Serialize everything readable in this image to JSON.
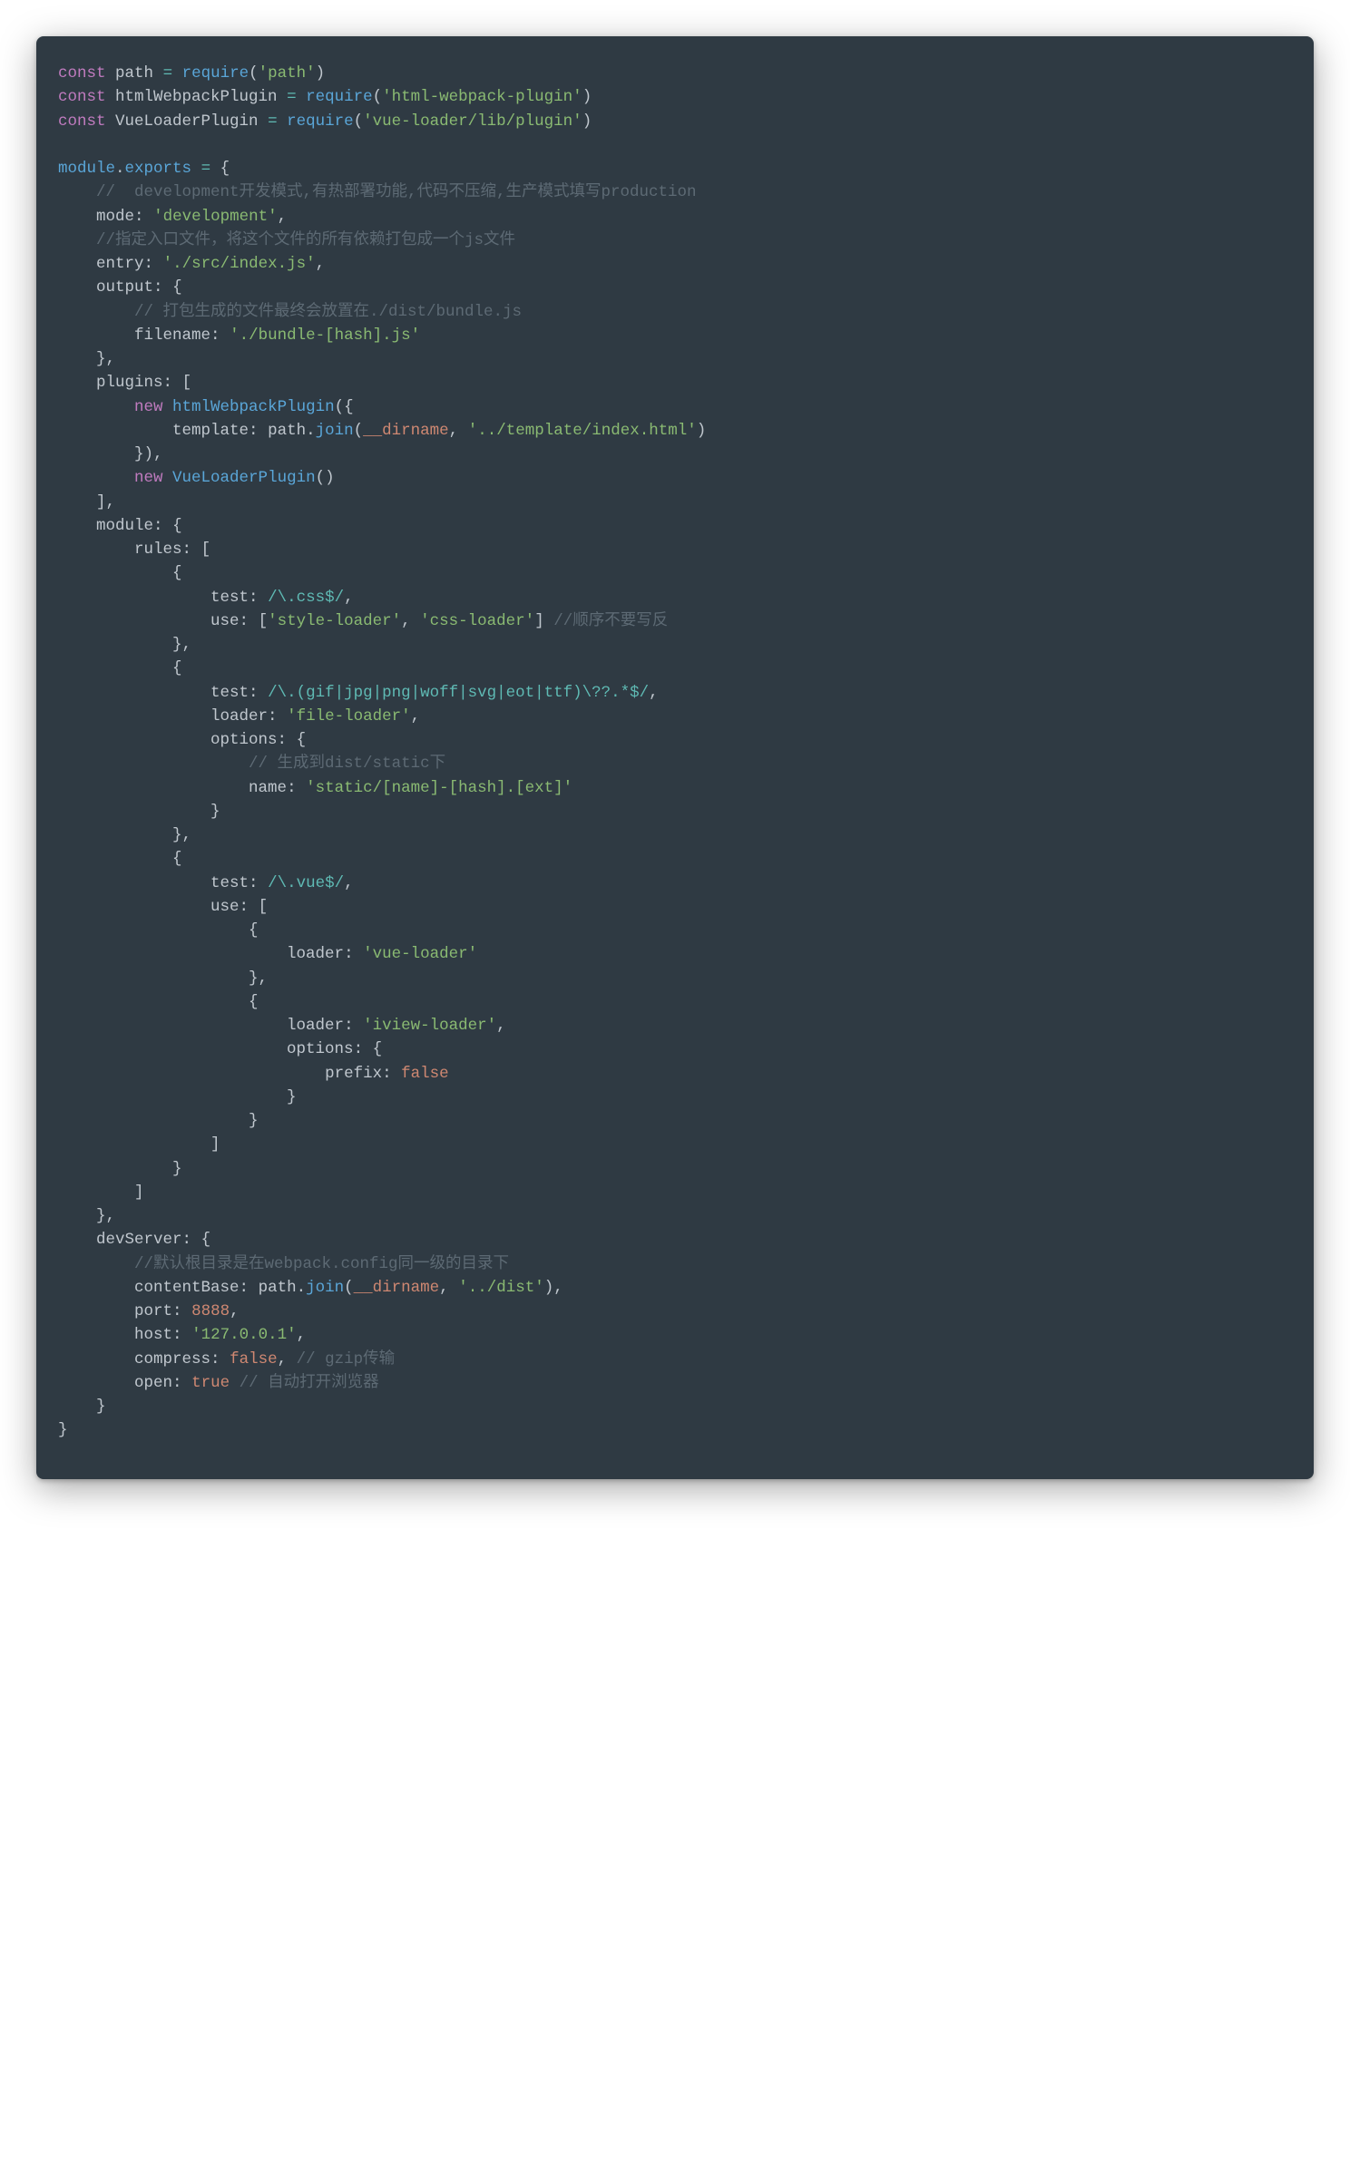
{
  "code": {
    "imports": {
      "const_kw": "const",
      "require_fn": "require",
      "path_var": "path",
      "path_mod": "'path'",
      "html_var": "htmlWebpackPlugin",
      "html_mod": "'html-webpack-plugin'",
      "vue_var": "VueLoaderPlugin",
      "vue_mod": "'vue-loader/lib/plugin'"
    },
    "exports_head": {
      "module": "module",
      "exports": "exports"
    },
    "comments": {
      "mode": "//  development开发模式,有热部署功能,代码不压缩,生产模式填写production",
      "entry": "//指定入口文件，将这个文件的所有依赖打包成一个js文件",
      "output": "// 打包生成的文件最终会放置在./dist/bundle.js",
      "use_css": "//顺序不要写反",
      "static": "// 生成到dist/static下",
      "contentBase": "//默认根目录是在webpack.config同一级的目录下",
      "gzip": "// gzip传输",
      "open": "// 自动打开浏览器"
    },
    "config": {
      "mode_key": "mode",
      "mode_val": "'development'",
      "entry_key": "entry",
      "entry_val": "'./src/index.js'",
      "output_key": "output",
      "filename_key": "filename",
      "filename_val": "'./bundle-[hash].js'",
      "plugins_key": "plugins",
      "new_kw": "new",
      "htmlPlugin": "htmlWebpackPlugin",
      "template_key": "template",
      "join_fn": "join",
      "dirname": "__dirname",
      "template_path": "'../template/index.html'",
      "vuePlugin": "VueLoaderPlugin",
      "module_key": "module",
      "rules_key": "rules",
      "test_key": "test",
      "use_key": "use",
      "loader_key": "loader",
      "options_key": "options",
      "name_key": "name",
      "prefix_key": "prefix",
      "css_test": "/\\.css$/",
      "style_loader": "'style-loader'",
      "css_loader": "'css-loader'",
      "file_test": "/\\.(gif|jpg|png|woff|svg|eot|ttf)\\??.*$/",
      "file_loader": "'file-loader'",
      "static_name": "'static/[name]-[hash].[ext]'",
      "vue_test": "/\\.vue$/",
      "vue_loader": "'vue-loader'",
      "iview_loader": "'iview-loader'",
      "false": "false",
      "true": "true",
      "devServer_key": "devServer",
      "contentBase_key": "contentBase",
      "dist_path": "'../dist'",
      "port_key": "port",
      "port_val": "8888",
      "host_key": "host",
      "host_val": "'127.0.0.1'",
      "compress_key": "compress",
      "open_key": "open"
    }
  }
}
